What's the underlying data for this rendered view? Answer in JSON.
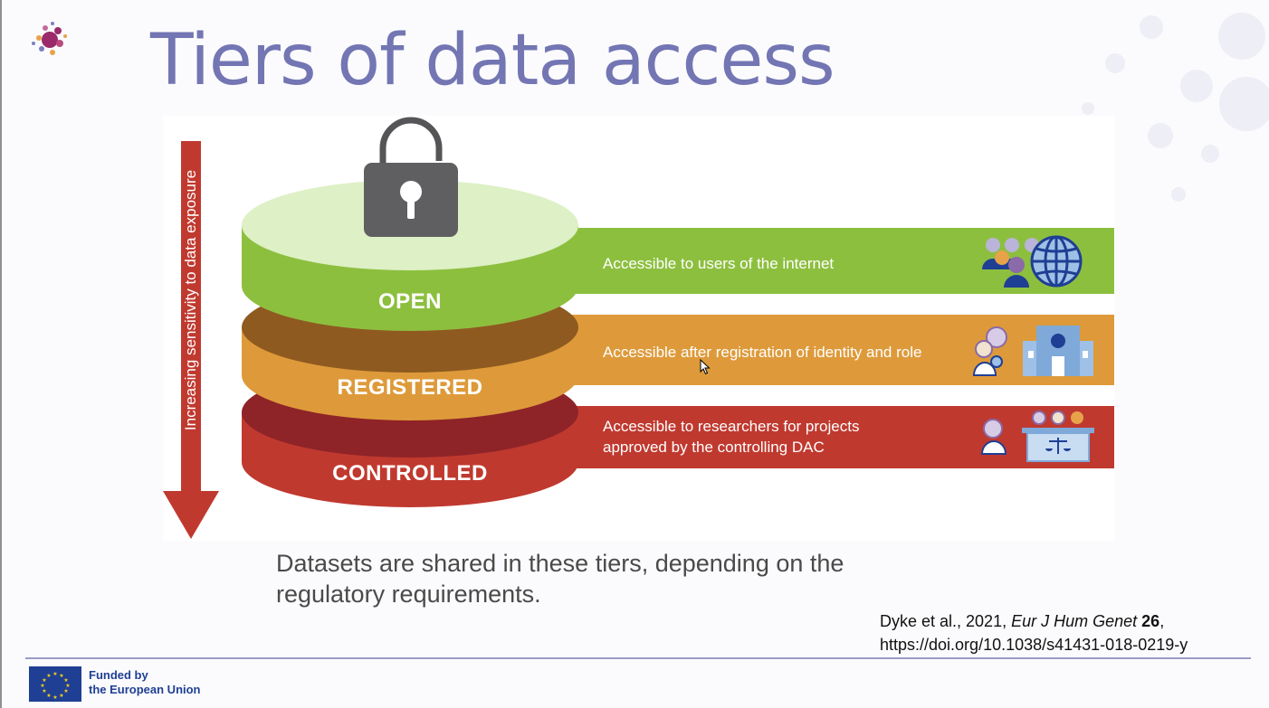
{
  "slide": {
    "title": "Tiers of data access"
  },
  "diagram": {
    "axis_label": "Increasing sensitivity to data exposure",
    "tiers": [
      {
        "label": "OPEN",
        "description": [
          "Accessible to users of the internet"
        ],
        "color": "#8dbf3f",
        "icons": [
          "users-group-icon",
          "globe-icon"
        ]
      },
      {
        "label": "REGISTERED",
        "description": [
          "Accessible after registration of identity and role"
        ],
        "color": "#de9a3a",
        "icons": [
          "researchers-icon",
          "institution-building-icon"
        ]
      },
      {
        "label": "CONTROLLED",
        "description": [
          "Accessible to researchers for projects",
          "approved by the controlling DAC"
        ],
        "color": "#c0392f",
        "icons": [
          "researcher-icon",
          "committee-scales-icon"
        ]
      }
    ],
    "lock_icon": "open-padlock-icon",
    "arrow_color": "#c0392f"
  },
  "caption": "Datasets are shared in these tiers, depending on the regulatory requirements.",
  "citation": {
    "authors": "Dyke et al., 2021, ",
    "journal": "Eur J Hum Genet",
    "volume": "26",
    "trail": ",",
    "doi": "https://doi.org/10.1038/s41431-018-0219-y"
  },
  "footer": {
    "funded_line1": "Funded by",
    "funded_line2": "the European Union"
  }
}
